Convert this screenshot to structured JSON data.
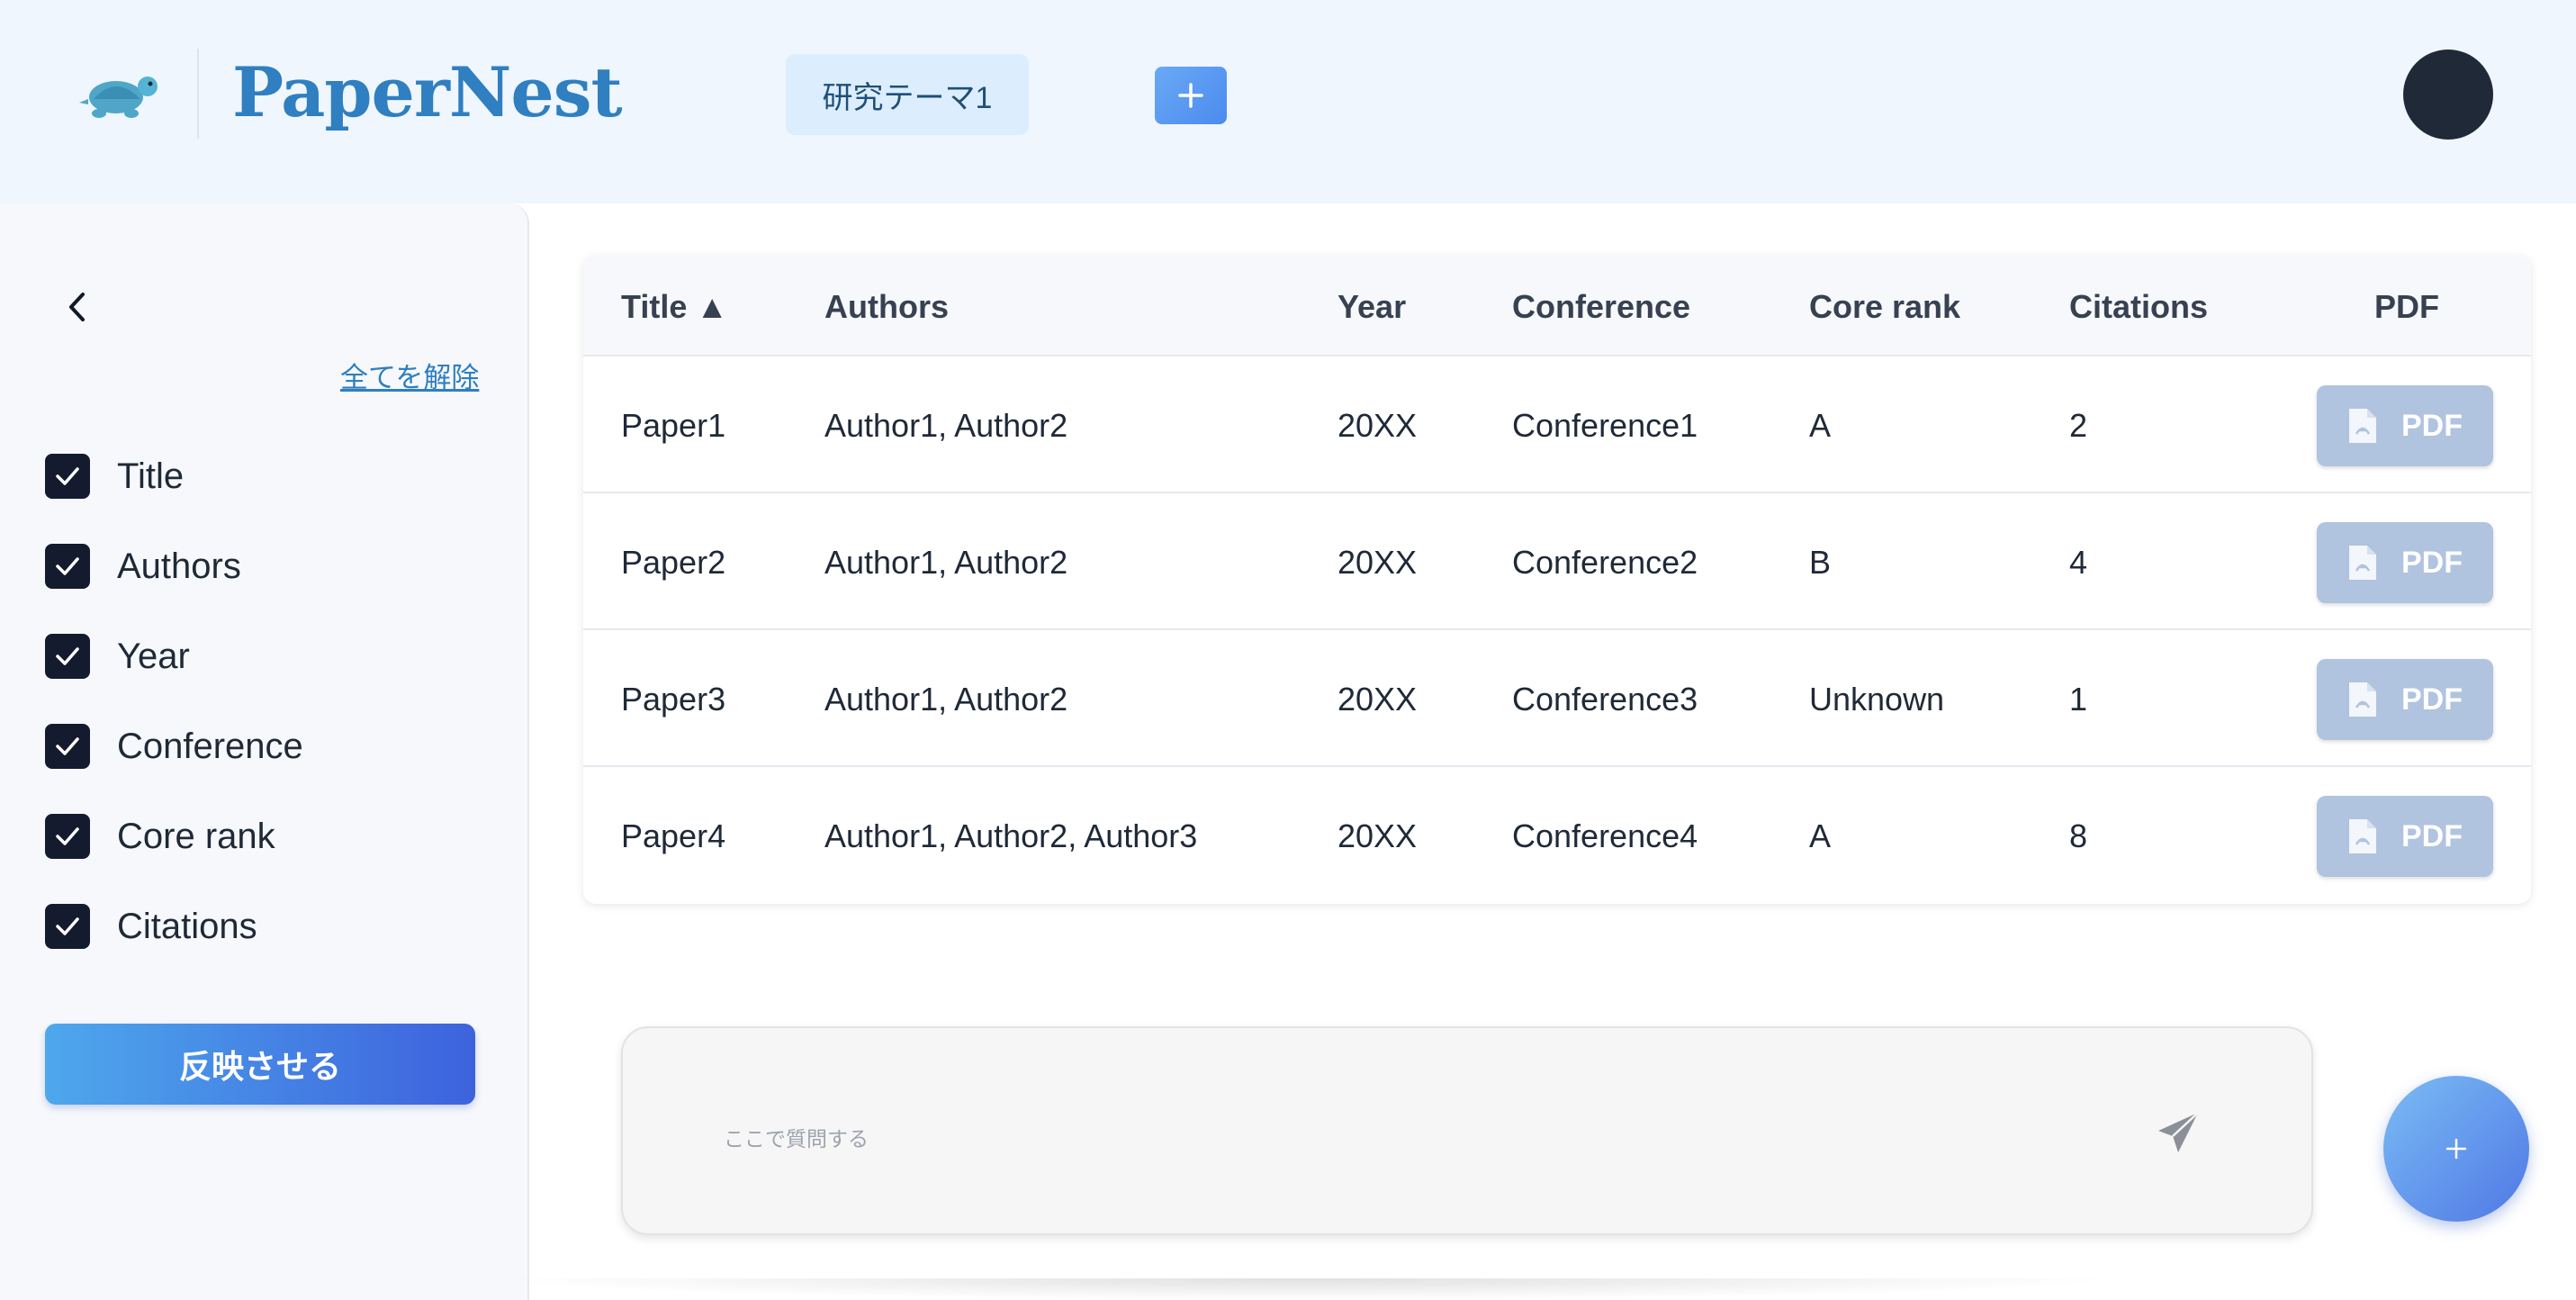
{
  "header": {
    "brand": "PaperNest",
    "topic_tab": "研究テーマ1",
    "logo_icon": "turtle-icon",
    "add_tab_icon": "plus-icon"
  },
  "sidebar": {
    "back_icon": "chevron-left-icon",
    "clear_all": "全てを解除",
    "filters": [
      {
        "label": "Title",
        "checked": true
      },
      {
        "label": "Authors",
        "checked": true
      },
      {
        "label": "Year",
        "checked": true
      },
      {
        "label": "Conference",
        "checked": true
      },
      {
        "label": "Core rank",
        "checked": true
      },
      {
        "label": "Citations",
        "checked": true
      }
    ],
    "apply_label": "反映させる"
  },
  "table": {
    "headers": {
      "title": "Title ▲",
      "authors": "Authors",
      "year": "Year",
      "conference": "Conference",
      "core_rank": "Core rank",
      "citations": "Citations",
      "pdf": "PDF"
    },
    "rows": [
      {
        "title": "Paper1",
        "authors": "Author1, Author2",
        "year": "20XX",
        "conference": "Conference1",
        "core_rank": "A",
        "citations": "2",
        "pdf": "PDF"
      },
      {
        "title": "Paper2",
        "authors": "Author1, Author2",
        "year": "20XX",
        "conference": "Conference2",
        "core_rank": "B",
        "citations": "4",
        "pdf": "PDF"
      },
      {
        "title": "Paper3",
        "authors": "Author1, Author2",
        "year": "20XX",
        "conference": "Conference3",
        "core_rank": "Unknown",
        "citations": "1",
        "pdf": "PDF"
      },
      {
        "title": "Paper4",
        "authors": "Author1, Author2, Author3",
        "year": "20XX",
        "conference": "Conference4",
        "core_rank": "A",
        "citations": "8",
        "pdf": "PDF"
      }
    ]
  },
  "chat": {
    "placeholder": "ここで質問する",
    "send_icon": "send-icon"
  },
  "fab_icon": "plus-icon",
  "colors": {
    "brand": "#2f7fc1",
    "header_bg": "#eff6fe",
    "checkbox": "#151b2e",
    "pdf_button": "#b0c3df"
  }
}
